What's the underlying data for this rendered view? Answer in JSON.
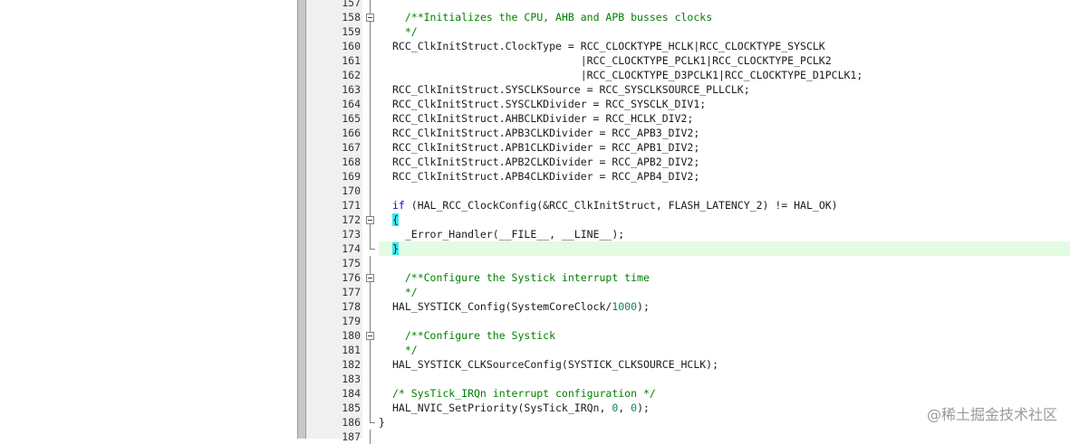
{
  "editor": {
    "lines": [
      {
        "n": "157",
        "fold": "line",
        "text": ""
      },
      {
        "n": "158",
        "fold": "box",
        "segs": [
          {
            "t": "  "
          },
          {
            "t": "/**Initializes the CPU, AHB and APB busses clocks",
            "c": "cm"
          }
        ]
      },
      {
        "n": "159",
        "fold": "line",
        "segs": [
          {
            "t": "  "
          },
          {
            "t": "*/",
            "c": "cm"
          }
        ]
      },
      {
        "n": "160",
        "fold": "line",
        "text": "RCC_ClkInitStruct.ClockType = RCC_CLOCKTYPE_HCLK|RCC_CLOCKTYPE_SYSCLK"
      },
      {
        "n": "161",
        "fold": "line",
        "text": "                              |RCC_CLOCKTYPE_PCLK1|RCC_CLOCKTYPE_PCLK2"
      },
      {
        "n": "162",
        "fold": "line",
        "text": "                              |RCC_CLOCKTYPE_D3PCLK1|RCC_CLOCKTYPE_D1PCLK1;"
      },
      {
        "n": "163",
        "fold": "line",
        "text": "RCC_ClkInitStruct.SYSCLKSource = RCC_SYSCLKSOURCE_PLLCLK;"
      },
      {
        "n": "164",
        "fold": "line",
        "text": "RCC_ClkInitStruct.SYSCLKDivider = RCC_SYSCLK_DIV1;"
      },
      {
        "n": "165",
        "fold": "line",
        "text": "RCC_ClkInitStruct.AHBCLKDivider = RCC_HCLK_DIV2;"
      },
      {
        "n": "166",
        "fold": "line",
        "text": "RCC_ClkInitStruct.APB3CLKDivider = RCC_APB3_DIV2;"
      },
      {
        "n": "167",
        "fold": "line",
        "text": "RCC_ClkInitStruct.APB1CLKDivider = RCC_APB1_DIV2;"
      },
      {
        "n": "168",
        "fold": "line",
        "text": "RCC_ClkInitStruct.APB2CLKDivider = RCC_APB2_DIV2;"
      },
      {
        "n": "169",
        "fold": "line",
        "text": "RCC_ClkInitStruct.APB4CLKDivider = RCC_APB4_DIV2;"
      },
      {
        "n": "170",
        "fold": "line",
        "text": ""
      },
      {
        "n": "171",
        "fold": "line",
        "segs": [
          {
            "t": "if",
            "c": "kw"
          },
          {
            "t": " (HAL_RCC_ClockConfig(&RCC_ClkInitStruct, FLASH_LATENCY_2) != HAL_OK)"
          }
        ]
      },
      {
        "n": "172",
        "fold": "box",
        "segs": [
          {
            "t": "{",
            "c": "brace"
          }
        ]
      },
      {
        "n": "173",
        "fold": "line",
        "text": "  _Error_Handler(__FILE__, __LINE__);"
      },
      {
        "n": "174",
        "fold": "end",
        "hl": true,
        "segs": [
          {
            "t": "}",
            "c": "brace"
          }
        ]
      },
      {
        "n": "175",
        "fold": "line",
        "text": ""
      },
      {
        "n": "176",
        "fold": "box",
        "segs": [
          {
            "t": "  "
          },
          {
            "t": "/**Configure the Systick interrupt time",
            "c": "cm"
          }
        ]
      },
      {
        "n": "177",
        "fold": "line",
        "segs": [
          {
            "t": "  "
          },
          {
            "t": "*/",
            "c": "cm"
          }
        ]
      },
      {
        "n": "178",
        "fold": "line",
        "segs": [
          {
            "t": "HAL_SYSTICK_Config(SystemCoreClock/"
          },
          {
            "t": "1000",
            "c": "num"
          },
          {
            "t": ");"
          }
        ]
      },
      {
        "n": "179",
        "fold": "line",
        "text": ""
      },
      {
        "n": "180",
        "fold": "box",
        "segs": [
          {
            "t": "  "
          },
          {
            "t": "/**Configure the Systick",
            "c": "cm"
          }
        ]
      },
      {
        "n": "181",
        "fold": "line",
        "segs": [
          {
            "t": "  "
          },
          {
            "t": "*/",
            "c": "cm"
          }
        ]
      },
      {
        "n": "182",
        "fold": "line",
        "text": "HAL_SYSTICK_CLKSourceConfig(SYSTICK_CLKSOURCE_HCLK);"
      },
      {
        "n": "183",
        "fold": "line",
        "text": ""
      },
      {
        "n": "184",
        "fold": "line",
        "segs": [
          {
            "t": "/* SysTick_IRQn interrupt configuration */",
            "c": "cm"
          }
        ]
      },
      {
        "n": "185",
        "fold": "line",
        "segs": [
          {
            "t": "HAL_NVIC_SetPriority(SysTick_IRQn, "
          },
          {
            "t": "0",
            "c": "num"
          },
          {
            "t": ", "
          },
          {
            "t": "0",
            "c": "num"
          },
          {
            "t": ");"
          }
        ]
      },
      {
        "n": "186",
        "fold": "end",
        "segs": [
          {
            "t": "}",
            "outdent": true
          }
        ]
      },
      {
        "n": "187",
        "fold": "line",
        "text": ""
      }
    ]
  },
  "watermark": {
    "text": "@稀土掘金技术社区"
  }
}
